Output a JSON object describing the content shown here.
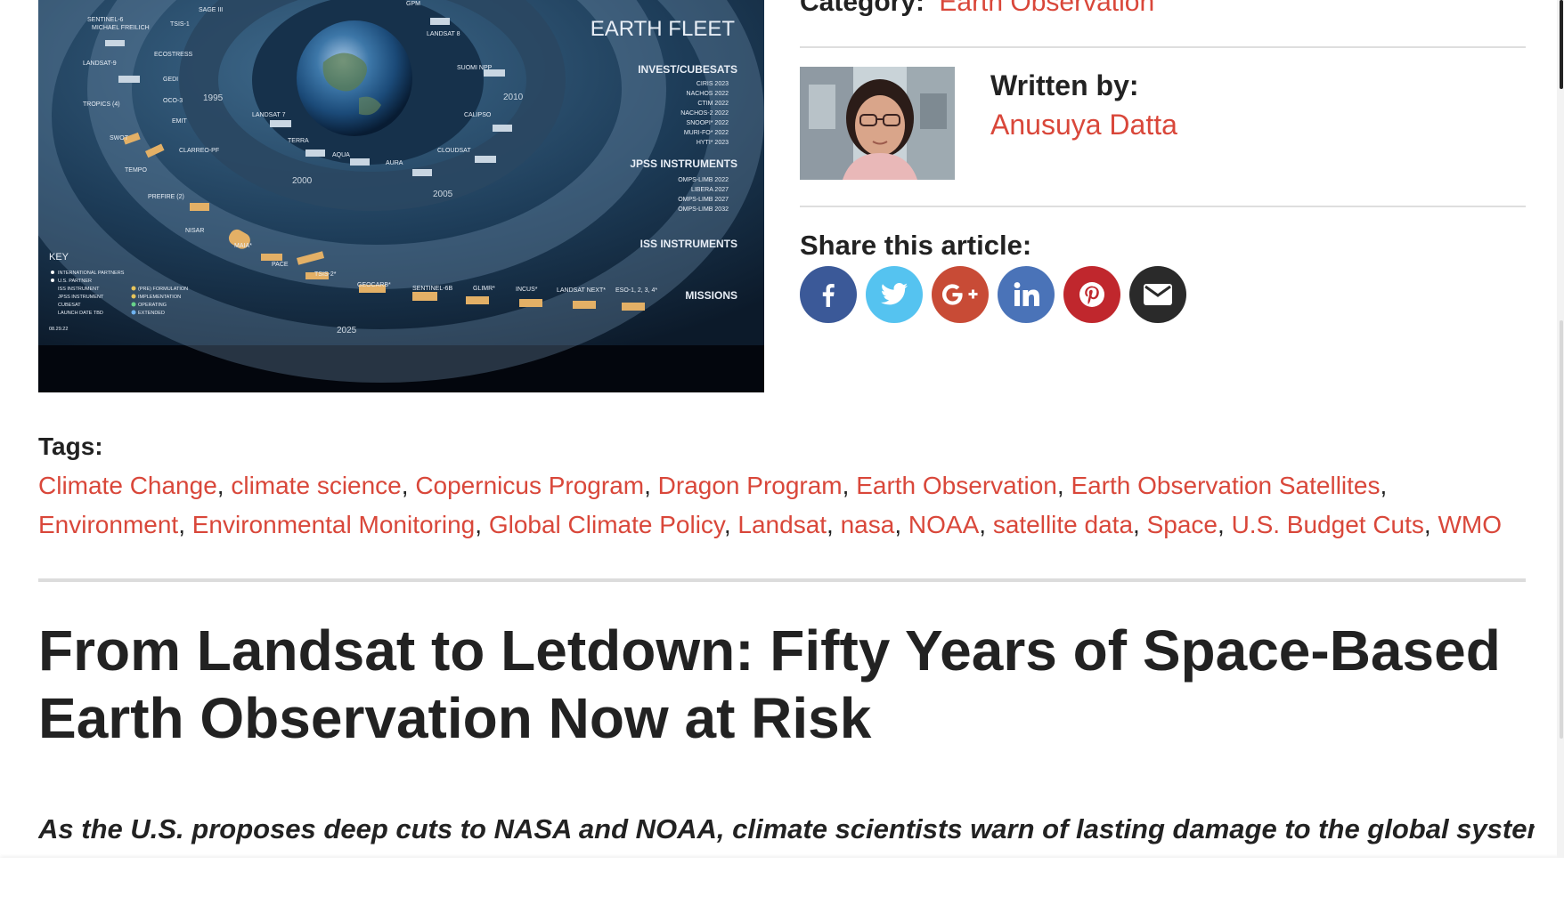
{
  "meta": {
    "category_label": "Category:",
    "category_value": "Earth Observation",
    "written_by_label": "Written by:",
    "author_name": "Anusuya Datta",
    "share_label": "Share this article:"
  },
  "share_buttons": [
    {
      "name": "facebook",
      "color": "#3b5998"
    },
    {
      "name": "twitter",
      "color": "#55c3f0"
    },
    {
      "name": "google-plus",
      "color": "#c84b36"
    },
    {
      "name": "linkedin",
      "color": "#4a73b8"
    },
    {
      "name": "pinterest",
      "color": "#c0272d"
    },
    {
      "name": "email",
      "color": "#2a2a2a"
    }
  ],
  "tags": {
    "label": "Tags:",
    "items": [
      "Climate Change",
      "climate science",
      "Copernicus Program",
      "Dragon Program",
      "Earth Observation",
      "Earth Observation Satellites",
      "Environment",
      "Environmental Monitoring",
      "Global Climate Policy",
      "Landsat",
      "nasa",
      "NOAA",
      "satellite data",
      "Space",
      "U.S. Budget Cuts",
      "WMO"
    ]
  },
  "article": {
    "title": "From Landsat to Letdown: Fifty Years of Space-Based Earth Observation Now at Risk",
    "lead": "As the U.S. proposes deep cuts to NASA and NOAA, climate scientists warn of lasting damage to the global systems we"
  },
  "hero_image": {
    "title": "EARTH FLEET",
    "sections": [
      "INVEST/CUBESATS",
      "JPSS INSTRUMENTS",
      "ISS INSTRUMENTS",
      "MISSIONS"
    ],
    "invest_items": [
      "CIRIS 2023",
      "NACHOS 2022",
      "CTIM 2022",
      "NACHOS-2 2022",
      "SNOOPI* 2022",
      "MURI-FO* 2022",
      "HYTI* 2023"
    ],
    "jpss_items": [
      "OMPS-LIMB 2022",
      "LIBERA 2027",
      "OMPS-LIMB 2027",
      "OMPS-LIMB 2032"
    ],
    "years": [
      "1995",
      "2000",
      "2005",
      "2010",
      "2025"
    ],
    "satellites_outer": [
      "SENTINEL-6 MICHAEL FREILICH",
      "TSIS-1",
      "SAGE III",
      "GPM",
      "LANDSAT 8",
      "SUOMI NPP",
      "CALIPSO",
      "CLOUDSAT",
      "AURA",
      "AQUA",
      "TERRA",
      "LANDSAT 7"
    ],
    "satellites_mid": [
      "LANDSAT-9",
      "ECOSTRESS",
      "GEDI",
      "OCO-3",
      "EMIT",
      "CLARREO-PF",
      "TROPICS (4)",
      "SWOT",
      "TEMPO",
      "PREFIRE (2)",
      "NISAR",
      "MAIA*",
      "PACE",
      "TSIS-2*",
      "GEOCARB*",
      "SENTINEL-6B",
      "GLIMR*",
      "INCUS*",
      "LANDSAT NEXT*",
      "ESO-1, 2, 3, 4*"
    ],
    "key_label": "KEY",
    "key_items": [
      "INTERNATIONAL PARTNERS",
      "U.S. PARTNER",
      "ISS INSTRUMENT",
      "JPSS INSTRUMENT",
      "CUBESAT",
      "LAUNCH DATE TBD",
      "(PRE) FORMULATION",
      "IMPLEMENTATION",
      "OPERATING",
      "EXTENDED"
    ],
    "date_stamp": "08.29.22"
  }
}
